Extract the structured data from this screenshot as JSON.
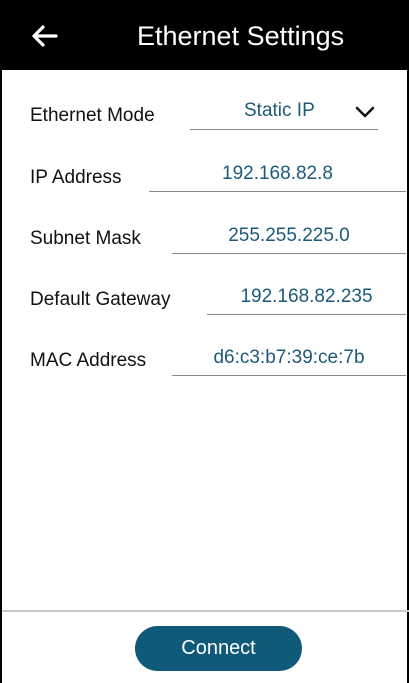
{
  "header": {
    "title": "Ethernet Settings",
    "back_icon": "arrow-left-icon"
  },
  "form": {
    "ethernet_mode": {
      "label": "Ethernet Mode",
      "value": "Static IP",
      "icon": "chevron-down-icon"
    },
    "ip_address": {
      "label": "IP Address",
      "value": "192.168.82.8"
    },
    "subnet_mask": {
      "label": "Subnet Mask",
      "value": "255.255.225.0"
    },
    "default_gateway": {
      "label": "Default Gateway",
      "value": "192.168.82.235"
    },
    "mac_address": {
      "label": "MAC Address",
      "value": "d6:c3:b7:39:ce:7b"
    }
  },
  "footer": {
    "connect_label": "Connect"
  },
  "colors": {
    "header_bg": "#000000",
    "value_text": "#1d5a7a",
    "button_bg": "#0f5a78"
  }
}
